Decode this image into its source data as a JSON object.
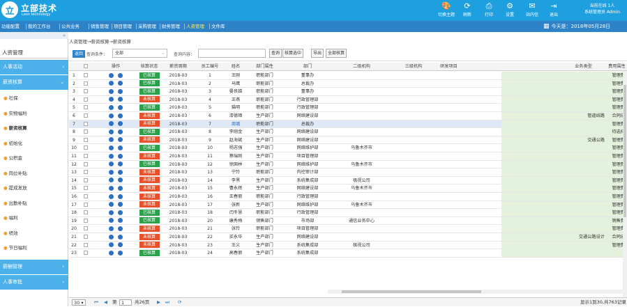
{
  "app": {
    "logo_text": "立",
    "brand": "立部技术",
    "brand_sub": "Leon technology",
    "user_line1": "当前在线 1人",
    "user_line2": "系统管理员 Admin"
  },
  "toolbar_icons": [
    {
      "label": "切换主题",
      "icon": "palette-icon",
      "glyph": "🎨"
    },
    {
      "label": "刷新",
      "icon": "refresh-icon",
      "glyph": "⟳"
    },
    {
      "label": "打印",
      "icon": "print-icon",
      "glyph": "⎙"
    },
    {
      "label": "设置",
      "icon": "gear-icon",
      "glyph": "⚙"
    },
    {
      "label": "站内信",
      "icon": "mail-icon",
      "glyph": "✉"
    },
    {
      "label": "退出",
      "icon": "logout-icon",
      "glyph": "⇥"
    }
  ],
  "menu": [
    "功能配置",
    "我的工作台",
    "公共业务",
    "销售管理",
    "项目管理",
    "采购管理",
    "财务管理",
    "人资管理",
    "文件库"
  ],
  "menu_active": "人资管理",
  "today": "今天是：2018年05月28日",
  "calendar_glyph": "▦",
  "sidebar": {
    "collapse": "«",
    "header": "人资管理",
    "groups": [
      {
        "label": "人事活动",
        "arrow": "›"
      },
      {
        "label": "薪资核算",
        "arrow": "⌄"
      },
      {
        "label": "薪酬管理",
        "arrow": "›"
      },
      {
        "label": "人事审批",
        "arrow": "›"
      }
    ],
    "items": [
      "社保",
      "实物福利",
      "薪资核算",
      "初始化",
      "公积金",
      "岗位补贴",
      "提成发放",
      "出勤补贴",
      "福利",
      "绩效",
      "节日福利"
    ],
    "active_item": "薪资核算",
    "dot": "●"
  },
  "breadcrumb": "人资管理→薪资核算→薪资核算",
  "search": {
    "back": "返回",
    "cond_label": "查询条件：",
    "cond_value": "全部",
    "caret": "⌵",
    "content_label": "查询内容：",
    "content_value": "",
    "buttons": [
      "查询",
      "核算选中",
      "导出",
      "全部核算"
    ]
  },
  "columns": [
    "",
    "",
    "操作",
    "核算状态",
    "薪资周期",
    "员工编号",
    "姓名",
    "部门属性",
    "部门",
    "二级机构",
    "三级机构",
    "研发项目",
    "",
    "业务类型",
    "费用属性"
  ],
  "rows": [
    [
      "1",
      "已核算",
      "2018-03",
      "1",
      "王刚",
      "职能部门",
      "董事办",
      "",
      "",
      "管理费"
    ],
    [
      "2",
      "已核算",
      "2018-03",
      "2",
      "马鹰",
      "职能部门",
      "总裁办",
      "",
      "",
      "管理费"
    ],
    [
      "3",
      "已核算",
      "2018-03",
      "3",
      "晏良娣",
      "职能部门",
      "董事办",
      "",
      "",
      "管理费"
    ],
    [
      "4",
      "未核算",
      "2018-03",
      "4",
      "王燕",
      "职能部门",
      "行政管理部",
      "",
      "",
      "管理费"
    ],
    [
      "5",
      "已核算",
      "2018-03",
      "5",
      "猫明",
      "职能部门",
      "行政管理部",
      "",
      "",
      "管理费"
    ],
    [
      "6",
      "未核算",
      "2018-03",
      "6",
      "漆德璋",
      "生产部门",
      "网络建设部",
      "",
      "管道线路",
      "合同成"
    ],
    [
      "7",
      "未核算",
      "2018-03",
      "7",
      "周璐",
      "职能部门",
      "总裁办",
      "",
      "",
      "管理费"
    ],
    [
      "8",
      "已核算",
      "2018-03",
      "8",
      "李刚金",
      "生产部门",
      "网络建设部",
      "",
      "",
      "待选择"
    ],
    [
      "9",
      "未核算",
      "2018-03",
      "9",
      "赵海斌",
      "生产部门",
      "网络建设部",
      "",
      "交通公路",
      "管理费"
    ],
    [
      "10",
      "已核算",
      "2018-03",
      "10",
      "杨志强",
      "生产部门",
      "网络维护部",
      "乌鲁木齐市",
      "",
      "管理费"
    ],
    [
      "11",
      "未核算",
      "2018-03",
      "11",
      "蔡瑞刚",
      "生产部门",
      "项目管理部",
      "",
      "",
      "管理费"
    ],
    [
      "12",
      "已核算",
      "2018-03",
      "12",
      "徐国林",
      "生产部门",
      "网络维护部",
      "乌鲁木齐市",
      "",
      "管理费"
    ],
    [
      "13",
      "未核算",
      "2018-03",
      "13",
      "宁玲",
      "职能部门",
      "内控审计部",
      "",
      "",
      "管理费"
    ],
    [
      "14",
      "未核算",
      "2018-03",
      "14",
      "李黑",
      "生产部门",
      "系统集成部",
      "极视公司",
      "",
      "管理费"
    ],
    [
      "15",
      "未核算",
      "2018-03",
      "15",
      "曹永辉",
      "生产部门",
      "网络建设部",
      "乌鲁木齐市",
      "",
      "管理费"
    ],
    [
      "16",
      "未核算",
      "2018-03",
      "16",
      "王春丽",
      "职能部门",
      "行政管理部",
      "",
      "",
      "管理费"
    ],
    [
      "17",
      "未核算",
      "2018-03",
      "17",
      "张新",
      "生产部门",
      "网络维护部",
      "乌鲁木齐市",
      "",
      "管理费"
    ],
    [
      "18",
      "已核算",
      "2018-03",
      "18",
      "闫冬慧",
      "职能部门",
      "行政管理部",
      "",
      "",
      "管理费"
    ],
    [
      "19",
      "已核算",
      "2018-03",
      "20",
      "康秀梅",
      "销售部门",
      "市场部",
      "通信业务中心",
      "",
      "销售费"
    ],
    [
      "20",
      "未核算",
      "2018-03",
      "21",
      "张玲",
      "职能部门",
      "项目管理部",
      "",
      "",
      "管理费"
    ],
    [
      "21",
      "未核算",
      "2018-03",
      "22",
      "买永华",
      "生产部门",
      "网络建设部",
      "",
      "交通公路设计",
      "合同成"
    ],
    [
      "22",
      "未核算",
      "2018-03",
      "23",
      "王义",
      "生产部门",
      "系统集成部",
      "极视公司",
      "",
      "管理费"
    ],
    [
      "23",
      "已核算",
      "2018-03",
      "24",
      "高春丽",
      "生产部门",
      "系统集成部",
      "",
      "",
      ""
    ]
  ],
  "selected_row": 7,
  "op_glyphs": [
    "◉",
    "◉"
  ],
  "pager": {
    "size": "30",
    "size_caret": "▾",
    "first": "⏮",
    "prev": "◀",
    "page_label": "第",
    "page": "1",
    "total": "共26页",
    "next": "▶",
    "last": "⏭",
    "refresh": "⟳",
    "summary": "显示1到30,共763记录"
  }
}
